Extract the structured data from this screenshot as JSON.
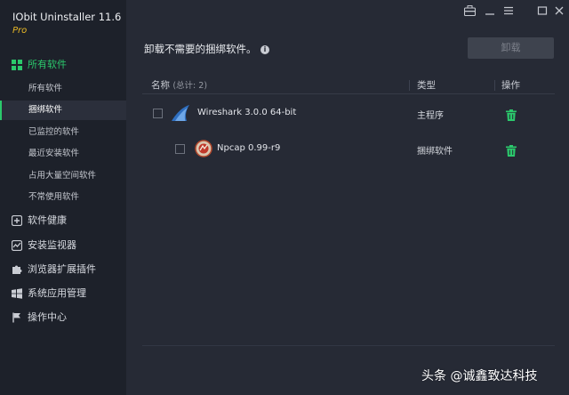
{
  "app": {
    "title": "IObit Uninstaller 11.6",
    "edition": "Pro"
  },
  "window_controls": [
    "toolbox-icon",
    "minimize-icon",
    "menu-icon",
    "maximize-icon",
    "close-icon"
  ],
  "sidebar": {
    "all_software": {
      "label": "所有软件",
      "icon": "grid-icon",
      "sub_items": [
        {
          "label": "所有软件"
        },
        {
          "label": "捆绑软件"
        },
        {
          "label": "已监控的软件"
        },
        {
          "label": "最近安装软件"
        },
        {
          "label": "占用大量空间软件"
        },
        {
          "label": "不常使用软件"
        }
      ]
    },
    "main_items": [
      {
        "label": "软件健康",
        "icon": "health-plus-icon"
      },
      {
        "label": "安装监视器",
        "icon": "monitor-wave-icon"
      },
      {
        "label": "浏览器扩展插件",
        "icon": "puzzle-icon"
      },
      {
        "label": "系统应用管理",
        "icon": "windows-icon"
      },
      {
        "label": "操作中心",
        "icon": "flag-icon"
      }
    ]
  },
  "main": {
    "headline": "卸载不需要的捆绑软件。",
    "uninstall_label": "卸载",
    "table": {
      "col_name": "名称",
      "col_total": "(总计: 2)",
      "col_type": "类型",
      "col_action": "操作",
      "rows": [
        {
          "name": "Wireshark 3.0.0 64-bit",
          "type": "主程序",
          "icon": "wireshark-fin-icon"
        },
        {
          "name": "Npcap 0.99-r9",
          "type": "捆绑软件",
          "icon": "npcap-icon"
        }
      ]
    }
  },
  "colors": {
    "accent": "#2bc96c",
    "edition": "#e9b826",
    "sidebar_bg": "#1d212a",
    "main_bg": "#262a35"
  },
  "watermark": "头条 @诚鑫致达科技"
}
